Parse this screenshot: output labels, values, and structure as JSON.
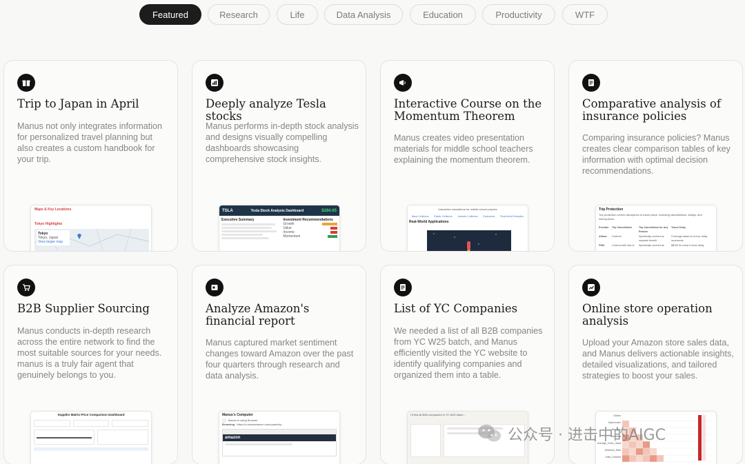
{
  "tabs": [
    "Featured",
    "Research",
    "Life",
    "Data Analysis",
    "Education",
    "Productivity",
    "WTF"
  ],
  "active_tab": "Featured",
  "cards": [
    {
      "icon": "gift-icon",
      "title": "Trip to Japan in April",
      "description": "Manus not only integrates information for personalized travel planning but also creates a custom handbook for your trip.",
      "preview": {
        "heading": "Maps & Key Locations",
        "subheading": "Tokyo Highlights",
        "label": "Tokyo",
        "sublabel": "Tokyo, Japan",
        "link": "View larger map"
      }
    },
    {
      "icon": "chart-icon",
      "title": "Deeply analyze Tesla stocks",
      "description": "Manus performs in-depth stock analysis and designs visually compelling dashboards showcasing comprehensive stock insights.",
      "preview": {
        "ticker": "TSLA",
        "heading": "Tesla Stock Analysis Dashboard",
        "price": "$284.65",
        "section": "Executive Summary",
        "side_section": "Investment Recommendations",
        "rows": [
          "Growth",
          "Value",
          "Income",
          "Momentum"
        ]
      }
    },
    {
      "icon": "megaphone-icon",
      "title": "Interactive Course on the Momentum Theorem",
      "description": "Manus creates video presentation materials for middle school teachers explaining the momentum theorem.",
      "preview": {
        "heading": "Interactive simulations for middle school physics",
        "nav": [
          "Basic Collisions",
          "Elastic Collisions",
          "Inelastic Collisions",
          "Explosions",
          "Real-World Examples"
        ],
        "section": "Real-World Applications"
      }
    },
    {
      "icon": "document-icon",
      "title": "Comparative analysis of insurance policies",
      "description": "Comparing insurance policies? Manus creates clear comparison tables of key information with optimal decision recommendations.",
      "preview": {
        "heading": "Trip Protection",
        "intro": "Trip protection covers disruptions to travel plans, including cancellations, delays, and interruptions.",
        "columns": [
          "Provider",
          "Trip Cancellation",
          "Trip Cancellation for Any Reason",
          "Travel Delay"
        ],
        "rows": [
          [
            "Allianz",
            "Covered",
            "Specifically covered as separate benefit",
            "Coverage based on 6-hour delay increments"
          ],
          [
            "FWD",
            "Covered with loss of",
            "Specifically covered as",
            "$$100 for every 6 hours delay"
          ]
        ]
      }
    },
    {
      "icon": "cart-icon",
      "title": "B2B Supplier Sourcing",
      "description": "Manus conducts in-depth research across the entire network to find the most suitable sources for your needs. manus is a truly fair agent that genuinely belongs to you.",
      "preview": {
        "heading": "Supplier Matrix Price Comparison Dashboard"
      }
    },
    {
      "icon": "folder-icon",
      "title": "Analyze Amazon's financial report",
      "description": "Manus captured market sentiment changes toward Amazon over the past four quarters through research and data analysis.",
      "preview": {
        "heading": "Manus's Computer",
        "status": "Manus is using Browser",
        "action": "Browsing",
        "url": "https://ir.aboutamazon.com/quarterly...",
        "brand": "amazon"
      }
    },
    {
      "icon": "list-icon",
      "title": "List of YC Companies",
      "description": "We needed a list of all B2B companies from YC W25 batch, and Manus efficiently visited the YC website to identify qualifying companies and organized them into a table.",
      "preview": {
        "line": "I'll find all B2B companies in YC W25 batch..."
      }
    },
    {
      "icon": "analytics-icon",
      "title": "Online store operation analysis",
      "description": "Upload your Amazon store sales data, and Manus delivers actionable insights, detailed visualizations, and tailored strategies to boost your sales.",
      "preview": {
        "rows": [
          "Orders",
          "Sales Index",
          "Buy Box",
          "Sessions",
          "Average_Order_Value",
          "Sessions_Rate",
          "Units_Ordered"
        ]
      }
    }
  ],
  "watermark": "公众号 · 进击中的AIGC",
  "colors": {
    "active_tab": "#1c1c1c",
    "accent_red": "#d43c3c",
    "tesla_dark": "#1f3448",
    "green": "#2e9e4e"
  }
}
